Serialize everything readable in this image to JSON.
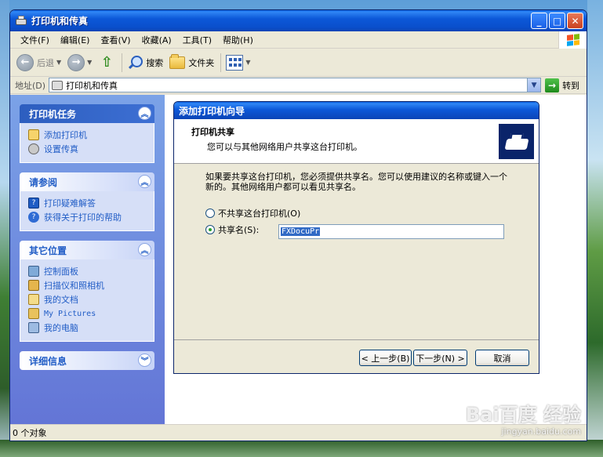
{
  "window": {
    "title": "打印机和传真",
    "min": "_",
    "max": "□",
    "close": "✕"
  },
  "menu": [
    "文件(F)",
    "编辑(E)",
    "查看(V)",
    "收藏(A)",
    "工具(T)",
    "帮助(H)"
  ],
  "toolbar": {
    "back": "后退",
    "search": "搜索",
    "folders": "文件夹"
  },
  "address": {
    "label": "地址(D)",
    "value": "打印机和传真",
    "go": "转到"
  },
  "taskpane": {
    "panels": [
      {
        "title": "打印机任务",
        "links": [
          "添加打印机",
          "设置传真"
        ]
      },
      {
        "title": "请参阅",
        "links": [
          "打印疑难解答",
          "获得关于打印的帮助"
        ]
      },
      {
        "title": "其它位置",
        "links": [
          "控制面板",
          "扫描仪和照相机",
          "我的文档",
          "My Pictures",
          "我的电脑"
        ]
      },
      {
        "title": "详细信息",
        "links": []
      }
    ]
  },
  "wizard": {
    "title": "添加打印机向导",
    "header_title": "打印机共享",
    "header_sub": "您可以与其他网络用户共享这台打印机。",
    "description": "如果要共享这台打印机，您必须提供共享名。您可以使用建议的名称或键入一个新的。其他网络用户都可以看见共享名。",
    "option_no_share": "不共享这台打印机(O)",
    "option_share": "共享名(S):",
    "share_name": "FXDocuPr",
    "btn_back": "< 上一步(B)",
    "btn_next": "下一步(N) >",
    "btn_cancel": "取消"
  },
  "status": {
    "text": "0 个对象"
  },
  "watermark": {
    "logo": "Bai百度 经验",
    "url": "jingyan.baidu.com"
  }
}
